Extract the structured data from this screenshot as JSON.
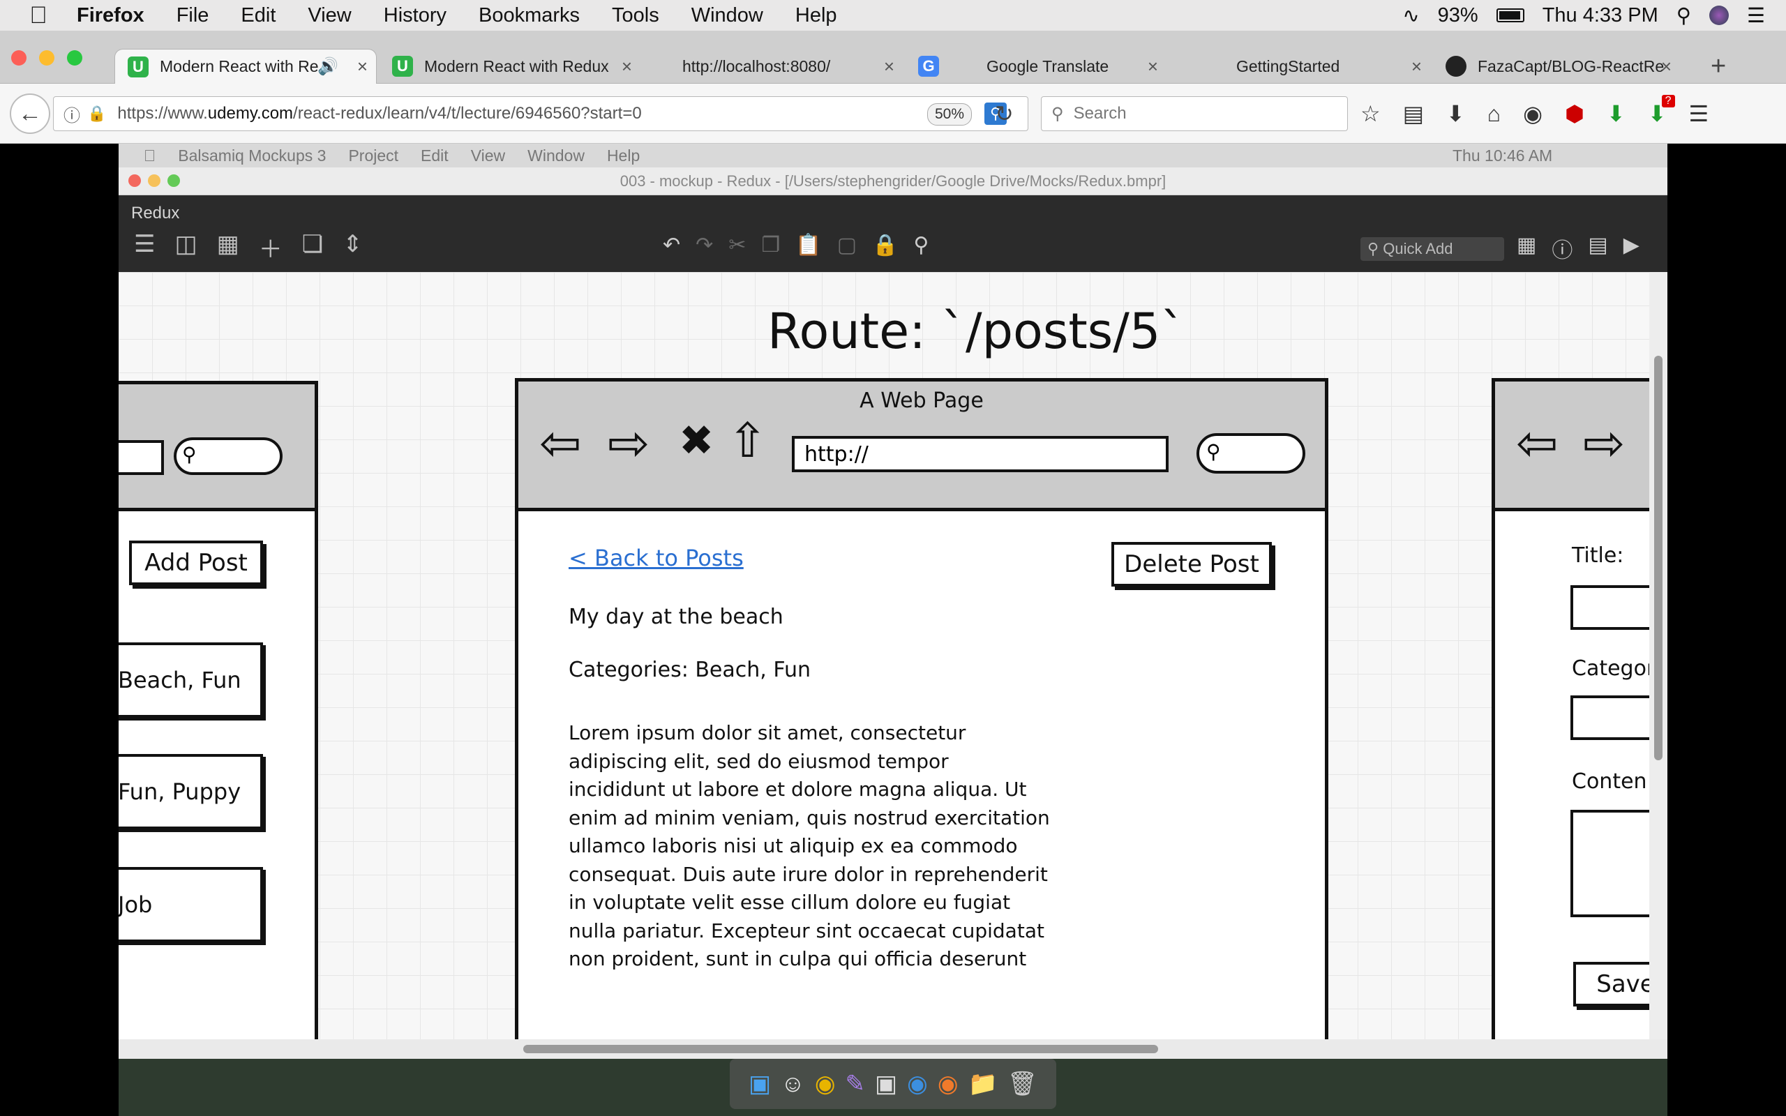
{
  "menubar": {
    "apple": "",
    "app": "Firefox",
    "items": [
      "File",
      "Edit",
      "View",
      "History",
      "Bookmarks",
      "Tools",
      "Window",
      "Help"
    ],
    "battery": "93%",
    "clock": "Thu 4:33 PM"
  },
  "tabs": [
    {
      "title": "Modern React with Re",
      "icon": "U"
    },
    {
      "title": "Modern React with Redux",
      "icon": "U"
    },
    {
      "title": "http://localhost:8080/",
      "icon": ""
    },
    {
      "title": "Google Translate",
      "icon": "G"
    },
    {
      "title": "GettingStarted",
      "icon": ""
    },
    {
      "title": "FazaCapt/BLOG-ReactRe",
      "icon": "gh"
    }
  ],
  "nav": {
    "url_prefix": "https://www.",
    "url_domain": "udemy.com",
    "url_path": "/react-redux/learn/v4/t/lecture/6946560?start=0",
    "zoom": "50%",
    "search_placeholder": "Search",
    "badge": "?"
  },
  "balsamiq": {
    "menubar": [
      "Balsamiq Mockups 3",
      "Project",
      "Edit",
      "View",
      "Window",
      "Help"
    ],
    "clock": "Thu 10:46 AM",
    "window_title": "003 - mockup - Redux - [/Users/stephengrider/Google Drive/Mocks/Redux.bmpr]",
    "app_name": "Redux",
    "quick_add": "Quick Add"
  },
  "mockup": {
    "route_title": "Route: `/posts/5`",
    "center": {
      "header_title": "A Web Page",
      "address": "http://",
      "back_link": "< Back to Posts",
      "delete_button": "Delete Post",
      "post_title": "My day at the beach",
      "categories": "Categories: Beach, Fun",
      "body": [
        "Lorem ipsum dolor sit amet, consectetur",
        "adipiscing elit, sed do eiusmod tempor",
        "incididunt ut labore et dolore magna aliqua. Ut",
        "enim ad minim veniam, quis nostrud exercitation",
        "ullamco laboris nisi ut aliquip ex ea commodo",
        "consequat. Duis aute irure dolor in reprehenderit",
        "in voluptate velit esse cillum dolore eu fugiat",
        "nulla pariatur. Excepteur sint occaecat cupidatat",
        "non proident, sunt in culpa qui officia deserunt"
      ]
    },
    "left": {
      "add_button": "Add Post",
      "items": [
        "Beach, Fun",
        "Fun, Puppy",
        "Job"
      ]
    },
    "right": {
      "title_label": "Title:",
      "categories_label": "Categor",
      "content_label": "Conten",
      "save_button": "Save"
    }
  }
}
